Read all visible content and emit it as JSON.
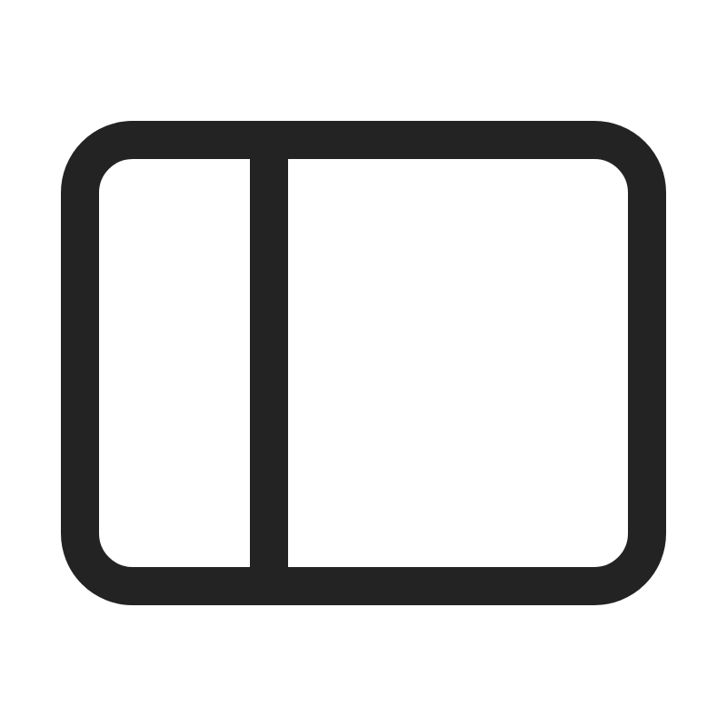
{
  "icon": {
    "name": "sidebar-panel-icon",
    "stroke_color": "#232323",
    "background_color": "#ffffff"
  }
}
